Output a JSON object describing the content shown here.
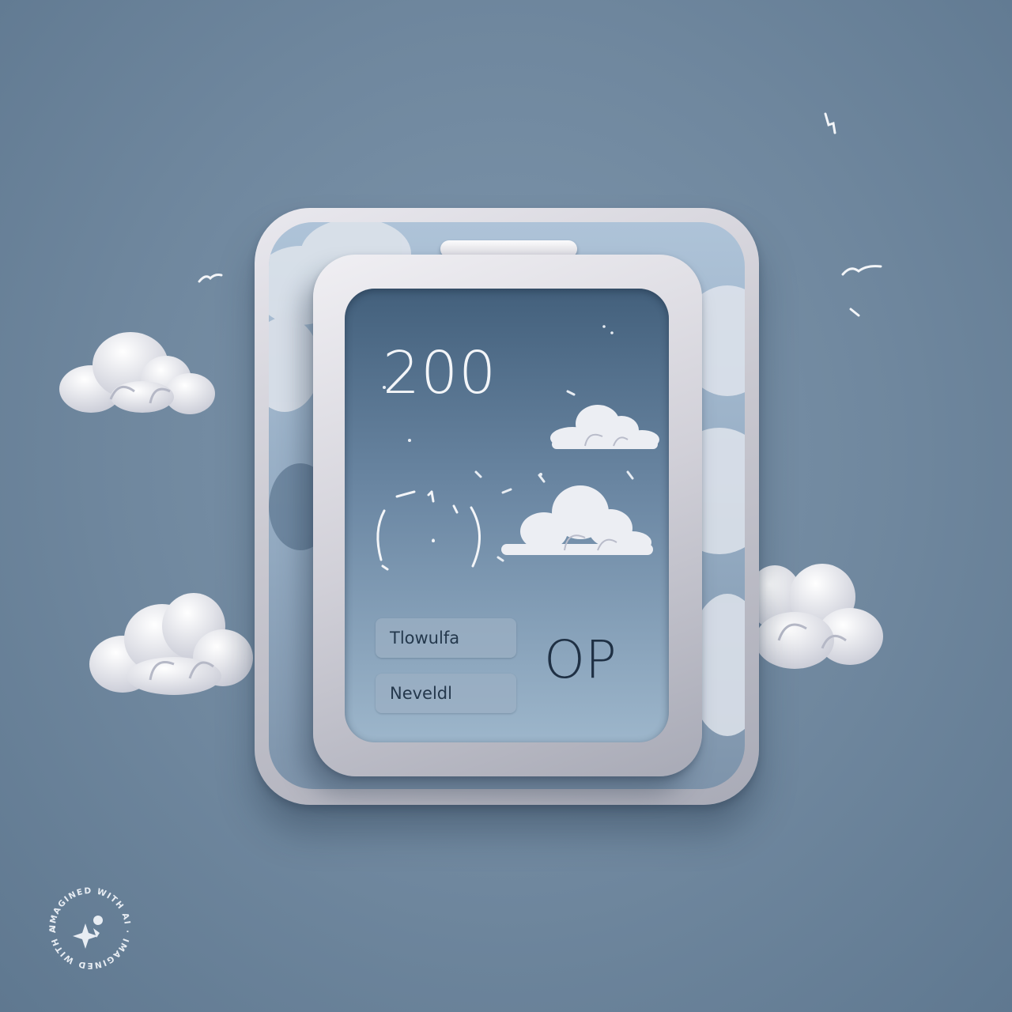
{
  "screen": {
    "main_value": "200",
    "chips": [
      {
        "label": "Tlowulfa"
      },
      {
        "label": "Neveldl"
      }
    ],
    "side_value": "OP"
  },
  "watermark": {
    "text": "IMAGINED WITH AI · IMAGINED WITH AI ·",
    "icon": "sparkle-icon"
  },
  "colors": {
    "background": "#7089a0",
    "screen_top": "#43607c",
    "frame": "#d1d0d8",
    "cloud": "#f0f0f4"
  }
}
